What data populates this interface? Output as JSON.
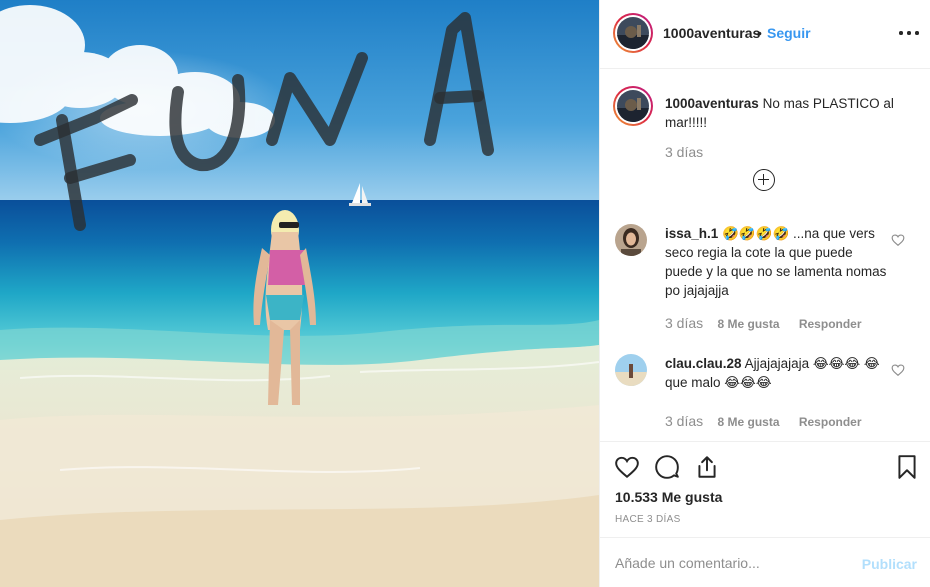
{
  "post": {
    "username": "1000aventuras",
    "separator": "•",
    "follow_label": "Seguir",
    "image_overlay_text": "FUNA"
  },
  "caption": {
    "username": "1000aventuras",
    "text": "No mas PLASTICO al mar!!!!!",
    "time": "3 días"
  },
  "comments": [
    {
      "username": "issa_h.1",
      "text": "🤣🤣🤣🤣 ...na que vers seco regia la cote la que puede puede y la que no se lamenta nomas po jajajajja",
      "time": "3 días",
      "likes": "8 Me gusta",
      "reply": "Responder"
    },
    {
      "username": "clau.clau.28",
      "text": "Ajjajajajaja 😂😂😂 😂 que malo 😂😂😂",
      "time": "3 días",
      "likes": "8 Me gusta",
      "reply": "Responder"
    }
  ],
  "stats": {
    "likes": "10.533 Me gusta",
    "age": "HACE 3 DÍAS"
  },
  "composer": {
    "placeholder": "Añade un comentario...",
    "publish_label": "Publicar"
  },
  "colors": {
    "accent": "#3897f0",
    "publish_disabled": "#b2dffc",
    "muted": "#8e8e8e",
    "text": "#262626"
  },
  "icons": [
    "more-options-icon",
    "load-more-icon",
    "heart-icon",
    "comment-icon",
    "share-icon",
    "bookmark-icon"
  ]
}
